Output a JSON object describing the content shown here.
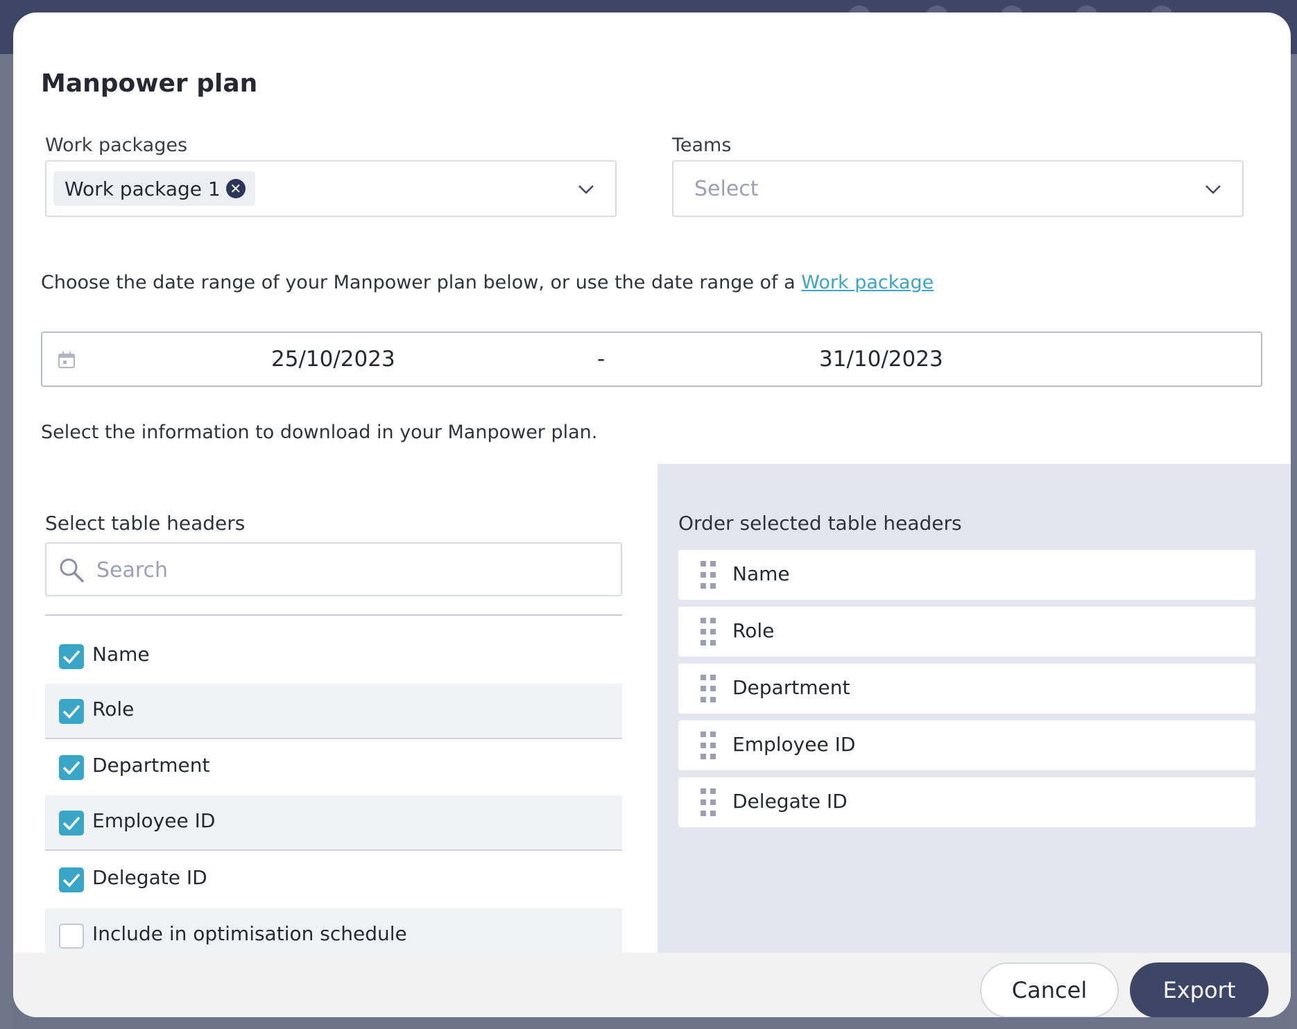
{
  "modal": {
    "title": "Manpower plan",
    "work_packages": {
      "label": "Work packages",
      "chips": [
        "Work package 1"
      ]
    },
    "teams": {
      "label": "Teams",
      "placeholder": "Select"
    },
    "date_helper": {
      "text": "Choose the date range of your Manpower plan below, or use the date range of a",
      "link": "Work package"
    },
    "date_range": {
      "start": "25/10/2023",
      "separator": "-",
      "end": "31/10/2023"
    },
    "info_text": "Select the information to download in your Manpower plan.",
    "select_headers": {
      "label": "Select table headers",
      "search_placeholder": "Search",
      "items": [
        {
          "label": "Name",
          "checked": true
        },
        {
          "label": "Role",
          "checked": true
        },
        {
          "label": "Department",
          "checked": true
        },
        {
          "label": "Employee ID",
          "checked": true
        },
        {
          "label": "Delegate ID",
          "checked": true
        },
        {
          "label": "Include in optimisation schedule",
          "checked": false
        }
      ]
    },
    "order_headers": {
      "label": "Order selected table headers",
      "items": [
        "Name",
        "Role",
        "Department",
        "Employee ID",
        "Delegate ID"
      ]
    },
    "footer": {
      "cancel": "Cancel",
      "export": "Export"
    }
  },
  "colors": {
    "accent": "#3aa6c7",
    "primary": "#3e4668",
    "panel": "#e3e6ef"
  }
}
